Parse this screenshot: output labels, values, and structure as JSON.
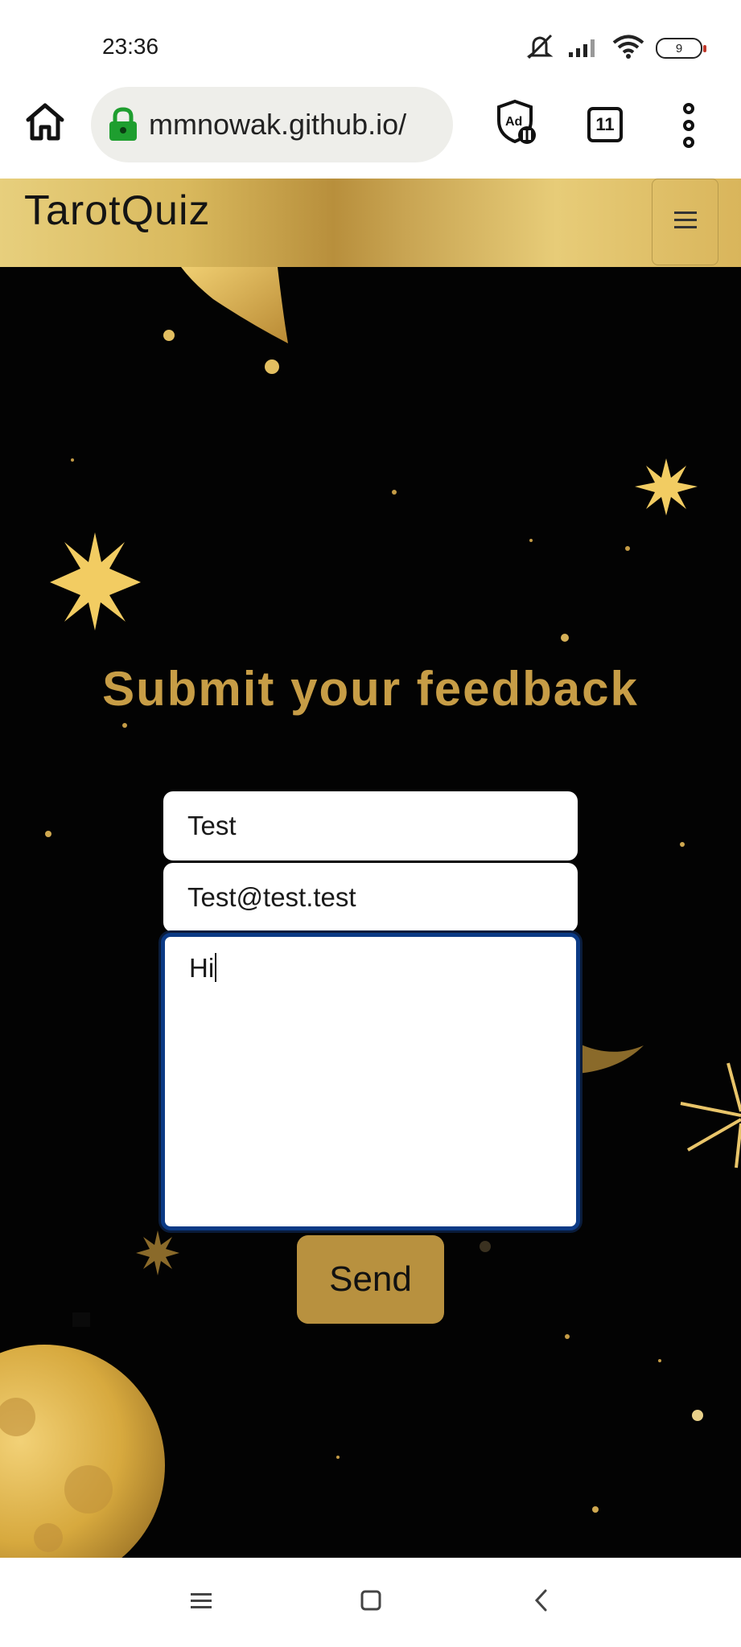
{
  "status_bar": {
    "time": "23:36",
    "battery_level": "9",
    "icons": [
      "mute-icon",
      "signal-icon",
      "wifi-icon",
      "battery-icon"
    ]
  },
  "browser": {
    "url": "mmnowak.github.io/",
    "tab_count": "11",
    "icons": [
      "home-icon",
      "lock-icon",
      "adblock-icon",
      "tabs-icon",
      "more-icon"
    ]
  },
  "site": {
    "brand": "TarotQuiz",
    "menu_icon": "hamburger-icon"
  },
  "feedback": {
    "heading": "Submit your feedback",
    "name_value": "Test",
    "email_value": "Test@test.test",
    "message_value": "Hi",
    "send_label": "Send"
  },
  "android_nav": {
    "icons": [
      "recents-icon",
      "home-square-icon",
      "back-icon"
    ]
  },
  "colors": {
    "gold_accent": "#c79d46",
    "button_gold": "#b8913f",
    "background": "#030303",
    "focus_border": "#0b3a85"
  }
}
